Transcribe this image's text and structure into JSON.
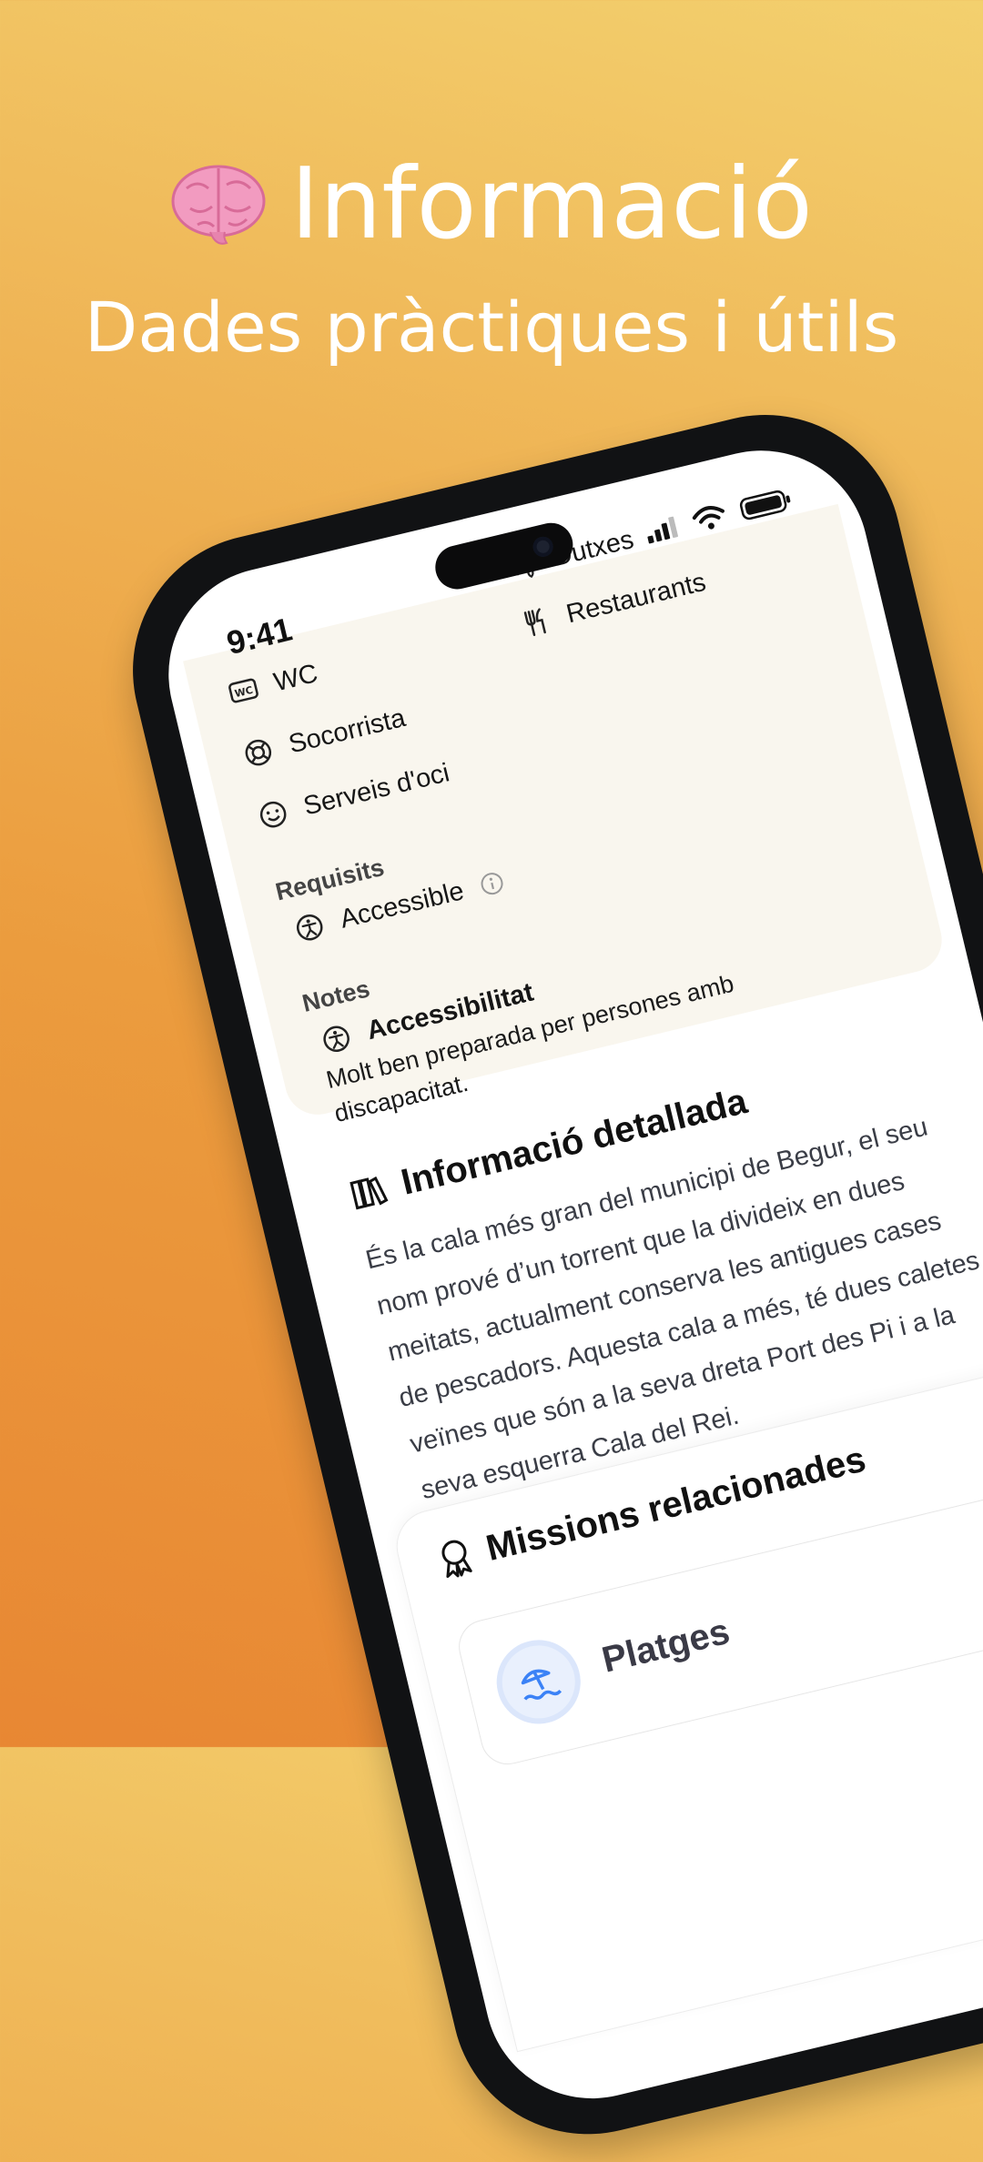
{
  "headline": {
    "title": "Informació",
    "subtitle": "Dades pràctiques i útils",
    "emoji_icon": "brain-icon"
  },
  "status_bar": {
    "time": "9:41",
    "icons": [
      "signal-icon",
      "wifi-icon",
      "battery-icon"
    ]
  },
  "services": {
    "left": [
      {
        "icon": "wc-icon",
        "label": "WC"
      },
      {
        "icon": "lifebuoy-icon",
        "label": "Socorrista"
      },
      {
        "icon": "smile-icon",
        "label": "Serveis d'oci"
      }
    ],
    "right": [
      {
        "icon": "droplets-icon",
        "label": "Dutxes"
      },
      {
        "icon": "fork-knife-icon",
        "label": "Restaurants"
      }
    ]
  },
  "requirements": {
    "label": "Requisits",
    "items": [
      {
        "icon": "accessibility-icon",
        "label": "Accessible",
        "info_icon": "info-icon"
      }
    ]
  },
  "notes": {
    "label": "Notes",
    "title": "Accessibilitat",
    "body": "Molt ben preparada per persones amb discapacitat."
  },
  "detailed_info": {
    "title": "Informació detallada",
    "icon": "books-icon",
    "text": "És la cala més gran del municipi de Begur, el seu nom prové d’un torrent que la divideix en dues meitats, actualment conserva les antigues cases de pescadors. Aquesta cala a més, té dues caletes veïnes que són a la seva dreta Port des Pi i a la seva esquerra Cala del Rei."
  },
  "missions": {
    "title": "Missions relacionades",
    "icon": "award-icon",
    "items": [
      {
        "name": "Platges",
        "icon": "beach-umbrella-icon"
      }
    ]
  },
  "colors": {
    "background_top": "#f3d06e",
    "background_bottom": "#e88733",
    "card_bg": "#f9f6ee",
    "mission_icon_bg": "#e9f0fd",
    "mission_icon_color": "#3b82f6"
  }
}
